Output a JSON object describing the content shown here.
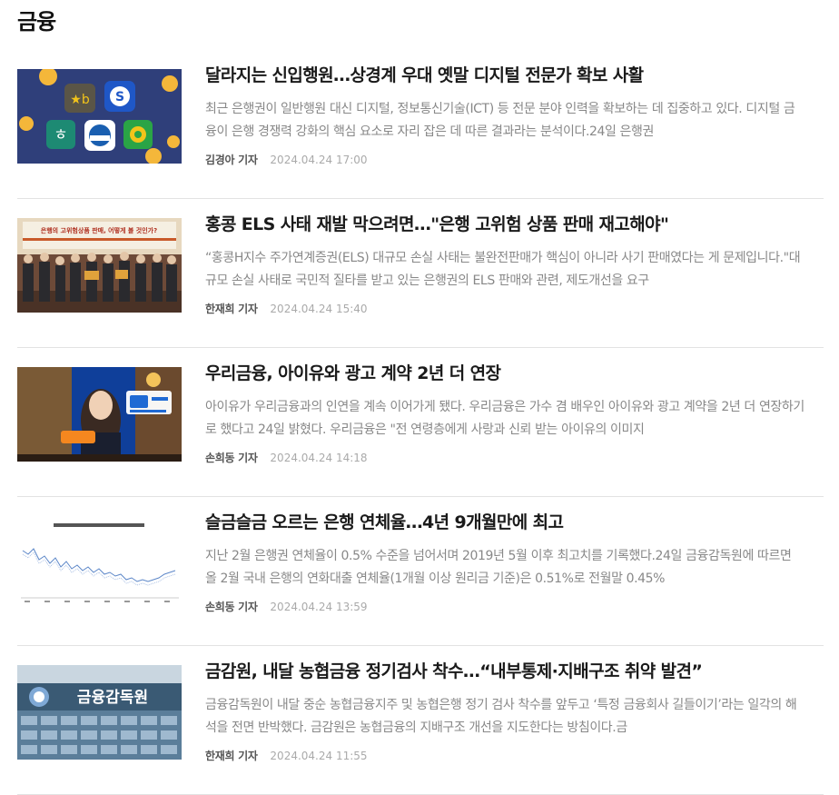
{
  "section": {
    "title": "금융"
  },
  "articles": [
    {
      "title": "달라지는 신입행원…상경계 우대 옛말 디지털 전문가 확보 사활",
      "summary": "최근 은행권이 일반행원 대신 디지털, 정보통신기술(ICT) 등 전문 분야 인력을 확보하는 데 집중하고 있다. 디지털 금융이 은행 경쟁력 강화의 핵심 요소로 자리 잡은 데 따른 결과라는 분석이다.24일 은행권",
      "author": "김경아 기자",
      "date": "2024.04.24 17:00"
    },
    {
      "title": "홍콩 ELS 사태 재발 막으려면…\"은행 고위험 상품 판매 재고해야\"",
      "summary": "“홍콩H지수 주가연계증권(ELS) 대규모 손실 사태는 불완전판매가 핵심이 아니라 사기 판매였다는 게 문제입니다.\"대규모 손실 사태로 국민적 질타를 받고 있는 은행권의 ELS 판매와 관련, 제도개선을 요구",
      "author": "한재희 기자",
      "date": "2024.04.24 15:40",
      "image_text": "은행의 고위험상품 판매, 어떻게 볼 것인가?"
    },
    {
      "title": "우리금융, 아이유와 광고 계약 2년 더 연장",
      "summary": "아이유가 우리금융과의 인연을 계속 이어가게 됐다. 우리금융은 가수 겸 배우인 아이유와 광고 계약을 2년 더 연장하기로 했다고 24일 밝혔다. 우리금융은 \"전 연령층에게 사랑과 신뢰 받는 아이유의 이미지",
      "author": "손희동 기자",
      "date": "2024.04.24 14:18"
    },
    {
      "title": "슬금슬금 오르는 은행 연체율…4년 9개월만에 최고",
      "summary": "지난 2월 은행권 연체율이 0.5% 수준을 넘어서며 2019년 5월 이후 최고치를 기록했다.24일 금융감독원에 따르면 올 2월 국내 은행의 연화대출 연체율(1개월 이상 원리금 기준)은 0.51%로 전월말 0.45%",
      "author": "손희동 기자",
      "date": "2024.04.24 13:59"
    },
    {
      "title": "금감원, 내달 농협금융 정기검사 착수…“내부통제·지배구조 취약 발견”",
      "summary": "금융감독원이 내달 중순 농협금융지주 및 농협은행 정기 검사 착수를 앞두고 ‘특정 금융회사 길들이기’라는 일각의 해석을 전면 반박했다. 금감원은 농협금융의 지배구조 개선을 지도한다는 방침이다.금",
      "author": "한재희 기자",
      "date": "2024.04.24 11:55",
      "image_text": "금융감독원"
    }
  ],
  "colors": {
    "title": "#1a1a1a",
    "summary": "#888888",
    "author": "#555555",
    "date": "#aaaaaa",
    "divider": "#e2e2e2"
  }
}
